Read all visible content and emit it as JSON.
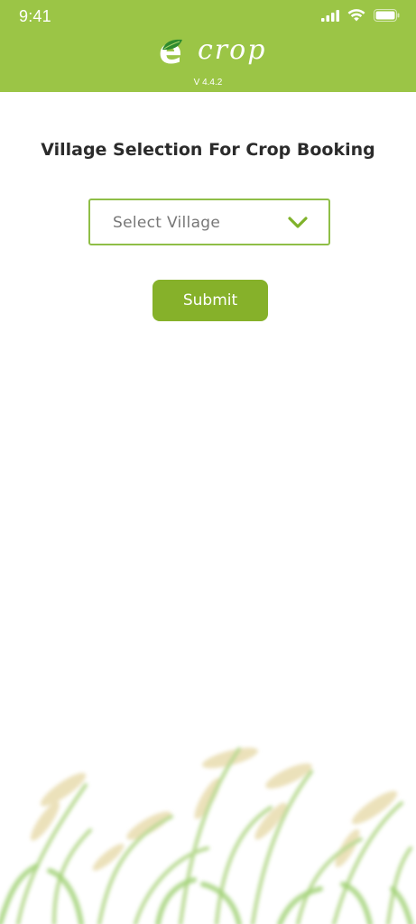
{
  "status_bar": {
    "time": "9:41",
    "icons": [
      "signal-icon",
      "wifi-icon",
      "battery-icon"
    ]
  },
  "header": {
    "logo_letter": "e",
    "logo_word": "crop",
    "version": "V 4.4.2",
    "background_color": "#9bc546"
  },
  "main": {
    "title": "Village Selection For Crop Booking",
    "village_select": {
      "placeholder": "Select Village",
      "icon": "chevron-down-icon",
      "border_color": "#8fbe47"
    },
    "submit_label": "Submit",
    "submit_color": "#86b12a"
  },
  "decoration": {
    "image": "rice-grass-illustration"
  }
}
